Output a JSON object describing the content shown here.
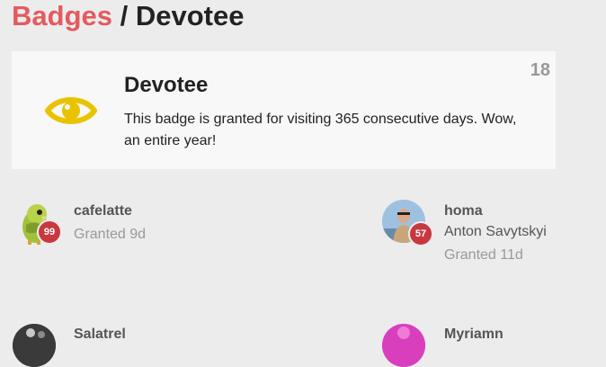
{
  "breadcrumb": {
    "parent": "Badges",
    "separator": " / ",
    "current": "Devotee"
  },
  "badge": {
    "name": "Devotee",
    "description": "This badge is granted for visiting 365 consecutive days. Wow, an entire year!",
    "granted_count": "18",
    "icon": "eye-icon",
    "icon_color": "#e9c300"
  },
  "colors": {
    "accent": "#e45a5e",
    "level_badge": "#c9373f"
  },
  "users": [
    {
      "username": "cafelatte",
      "full_name": "",
      "granted": "Granted 9d",
      "level": "99"
    },
    {
      "username": "homa",
      "full_name": "Anton Savytskyi",
      "granted": "Granted 11d",
      "level": "57"
    },
    {
      "username": "Salatrel",
      "full_name": "",
      "granted": "",
      "level": ""
    },
    {
      "username": "Myriamn",
      "full_name": "",
      "granted": "",
      "level": ""
    }
  ]
}
